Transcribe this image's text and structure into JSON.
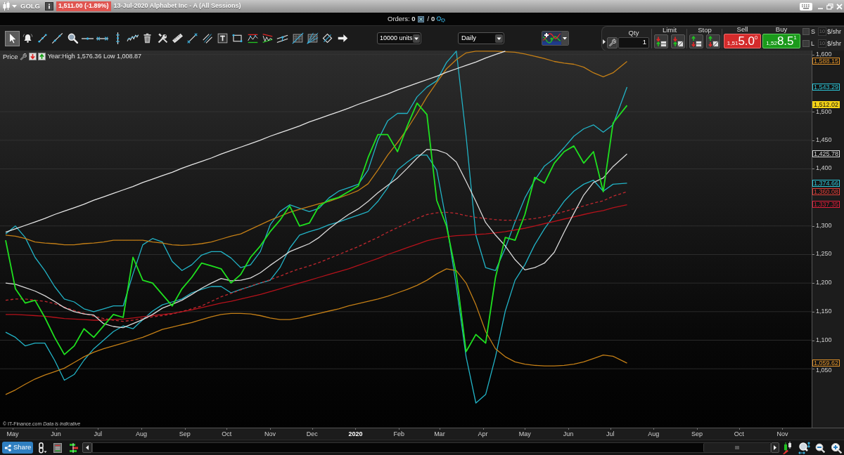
{
  "title_bar": {
    "symbol": "GOLG",
    "quote": {
      "text": "1,511.00 (-1.89%)",
      "down": true
    },
    "description": "13-Jul-2020 Alphabet Inc - A (All Sessions)"
  },
  "orders_bar": {
    "orders": "Orders: **0**",
    "filled": "/ **0**"
  },
  "toolbar": {
    "tools": [
      {
        "kind": "pointer",
        "selected": true
      },
      {
        "kind": "alert",
        "selected": false
      },
      {
        "kind": "segment",
        "selected": false
      },
      {
        "kind": "line",
        "selected": false
      },
      {
        "kind": "zoom",
        "selected": false
      },
      {
        "kind": "hline",
        "selected": false
      },
      {
        "kind": "hray",
        "selected": false
      },
      {
        "kind": "vline",
        "selected": false
      },
      {
        "kind": "wave",
        "selected": false
      },
      {
        "kind": "trash",
        "selected": false
      },
      {
        "kind": "tools",
        "selected": false
      },
      {
        "kind": "ruler",
        "selected": false
      },
      {
        "kind": "arrows",
        "selected": false
      },
      {
        "kind": "parallel",
        "selected": false
      },
      {
        "kind": "text",
        "selected": false
      },
      {
        "kind": "rect",
        "selected": false
      },
      {
        "kind": "channel",
        "selected": false
      },
      {
        "kind": "wedge",
        "selected": false
      },
      {
        "kind": "trend-channel",
        "selected": false
      },
      {
        "kind": "grid",
        "selected": false
      },
      {
        "kind": "grid-fan",
        "selected": false
      },
      {
        "kind": "diamond",
        "selected": false
      },
      {
        "kind": "arrow",
        "selected": false
      }
    ],
    "units": "10000 units",
    "interval": "Daily"
  },
  "trade_ticket": {
    "qty": {
      "label": "Qty",
      "value": "1"
    },
    "limit_label": "Limit",
    "stop_label": "Stop",
    "quotes": [
      {
        "kind": "sell",
        "label": "Sell",
        "prefix": "1,51",
        "big": "5.0",
        "pip": "0"
      },
      {
        "kind": "buy",
        "label": "Buy",
        "prefix": "1,52",
        "big": "8.5",
        "pip": "1"
      }
    ],
    "protections": [
      {
        "letter": "S",
        "checked": false,
        "amount": "10",
        "disabled": true,
        "unit": "$/shr"
      },
      {
        "letter": "L",
        "checked": false,
        "amount": "10",
        "disabled": true,
        "unit": "$/shr"
      }
    ]
  },
  "chart": {
    "header": {
      "label": "Price",
      "stats": "Year:High 1,576.36 Low 1,008.87"
    },
    "credit": "© IT-Finance.com *Data is indicative*",
    "price_tags": [
      {
        "text": "1,588.15",
        "color": "#e0922a",
        "filled": false
      },
      {
        "text": "1,543.29",
        "color": "#2cc6d8",
        "filled": false
      },
      {
        "text": "1,512.02",
        "color": "#f5d316",
        "filled": true
      },
      {
        "text": "1,425.78",
        "color": "#d6d6d6",
        "filled": false
      },
      {
        "text": "1,374.66",
        "color": "#2cc6d8",
        "filled": false
      },
      {
        "text": "1,360.08",
        "color": "#e0403a",
        "filled": false
      },
      {
        "text": "1,337.35",
        "color": "#e0203c",
        "filled": false
      },
      {
        "text": "1,059.62",
        "color": "#e0922a",
        "filled": false
      }
    ],
    "chart_data": {
      "type": "line",
      "grid": true,
      "xlim": [
        "2019-04-22",
        "2020-12-15"
      ],
      "ylim": [
        947,
        1607
      ],
      "x": [
        "2019-04-26",
        "2019-05-03",
        "2019-05-10",
        "2019-05-17",
        "2019-05-24",
        "2019-05-31",
        "2019-06-07",
        "2019-06-14",
        "2019-06-21",
        "2019-06-28",
        "2019-07-05",
        "2019-07-12",
        "2019-07-19",
        "2019-07-26",
        "2019-08-02",
        "2019-08-09",
        "2019-08-16",
        "2019-08-23",
        "2019-08-30",
        "2019-09-06",
        "2019-09-13",
        "2019-09-20",
        "2019-09-27",
        "2019-10-04",
        "2019-10-11",
        "2019-10-18",
        "2019-10-25",
        "2019-11-01",
        "2019-11-08",
        "2019-11-15",
        "2019-11-22",
        "2019-11-29",
        "2019-12-06",
        "2019-12-13",
        "2019-12-20",
        "2019-12-27",
        "2020-01-03",
        "2020-01-10",
        "2020-01-17",
        "2020-01-24",
        "2020-01-31",
        "2020-02-07",
        "2020-02-14",
        "2020-02-21",
        "2020-02-28",
        "2020-03-06",
        "2020-03-13",
        "2020-03-20",
        "2020-03-27",
        "2020-04-03",
        "2020-04-10",
        "2020-04-17",
        "2020-04-24",
        "2020-05-01",
        "2020-05-08",
        "2020-05-15",
        "2020-05-22",
        "2020-05-29",
        "2020-06-05",
        "2020-06-12",
        "2020-06-19",
        "2020-06-26",
        "2020-07-03",
        "2020-07-13"
      ],
      "xticks": [
        {
          "value": "2019-05-01",
          "label": "May"
        },
        {
          "value": "2019-06-01",
          "label": "Jun"
        },
        {
          "value": "2019-07-01",
          "label": "Jul"
        },
        {
          "value": "2019-08-01",
          "label": "Aug"
        },
        {
          "value": "2019-09-01",
          "label": "Sep"
        },
        {
          "value": "2019-10-01",
          "label": "Oct"
        },
        {
          "value": "2019-11-01",
          "label": "Nov"
        },
        {
          "value": "2019-12-01",
          "label": "Dec"
        },
        {
          "value": "2020-01-01",
          "label": "2020"
        },
        {
          "value": "2020-02-01",
          "label": "Feb"
        },
        {
          "value": "2020-03-01",
          "label": "Mar"
        },
        {
          "value": "2020-04-01",
          "label": "Apr"
        },
        {
          "value": "2020-05-01",
          "label": "May"
        },
        {
          "value": "2020-06-01",
          "label": "Jun"
        },
        {
          "value": "2020-07-01",
          "label": "Jul"
        },
        {
          "value": "2020-08-01",
          "label": "Aug"
        },
        {
          "value": "2020-09-01",
          "label": "Sep"
        },
        {
          "value": "2020-10-01",
          "label": "Oct"
        },
        {
          "value": "2020-11-01",
          "label": "Nov"
        }
      ],
      "yticks": [
        {
          "value": 1050,
          "label": "1,050"
        },
        {
          "value": 1100,
          "label": "1,100"
        },
        {
          "value": 1150,
          "label": "1,150"
        },
        {
          "value": 1200,
          "label": "1,200"
        },
        {
          "value": 1250,
          "label": "1,250"
        },
        {
          "value": 1300,
          "label": "1,300"
        },
        {
          "value": 1400,
          "label": "1,400"
        },
        {
          "value": 1450,
          "label": "1,450"
        },
        {
          "value": 1500,
          "label": "1,500"
        },
        {
          "value": 1600,
          "label": "1,600"
        }
      ],
      "series": [
        {
          "color": "#1fe01f",
          "values": [
            1275,
            1190,
            1165,
            1170,
            1140,
            1105,
            1075,
            1090,
            1120,
            1105,
            1125,
            1145,
            1140,
            1245,
            1205,
            1200,
            1180,
            1160,
            1190,
            1210,
            1235,
            1230,
            1225,
            1200,
            1215,
            1245,
            1265,
            1290,
            1310,
            1335,
            1300,
            1305,
            1335,
            1345,
            1350,
            1360,
            1370,
            1420,
            1460,
            1460,
            1430,
            1475,
            1515,
            1495,
            1345,
            1300,
            1215,
            1080,
            1110,
            1095,
            1210,
            1280,
            1275,
            1320,
            1385,
            1375,
            1410,
            1430,
            1440,
            1410,
            1430,
            1360,
            1480,
            1511
          ]
        },
        {
          "color": "#22b3c6",
          "values": [
            1286,
            1300,
            1280,
            1245,
            1222,
            1194,
            1172,
            1167,
            1155,
            1150,
            1155,
            1160,
            1160,
            1216,
            1267,
            1278,
            1272,
            1238,
            1222,
            1232,
            1249,
            1255,
            1255,
            1244,
            1227,
            1232,
            1255,
            1302,
            1325,
            1337,
            1331,
            1325,
            1331,
            1349,
            1361,
            1367,
            1373,
            1398,
            1450,
            1484,
            1497,
            1497,
            1526,
            1543,
            1554,
            1586,
            1606,
            1457,
            1284,
            1227,
            1222,
            1261,
            1307,
            1349,
            1380,
            1405,
            1418,
            1437,
            1457,
            1470,
            1477,
            1464,
            1477,
            1543
          ]
        },
        {
          "color": "#22b3c6",
          "values": [
            1114,
            1105,
            1090,
            1095,
            1095,
            1065,
            1030,
            1040,
            1065,
            1085,
            1100,
            1115,
            1125,
            1120,
            1136,
            1151,
            1162,
            1167,
            1172,
            1183,
            1189,
            1194,
            1194,
            1183,
            1189,
            1194,
            1200,
            1205,
            1227,
            1261,
            1284,
            1290,
            1295,
            1302,
            1307,
            1313,
            1319,
            1325,
            1343,
            1367,
            1398,
            1412,
            1424,
            1424,
            1398,
            1307,
            1194,
            1071,
            990,
            1005,
            1071,
            1151,
            1205,
            1232,
            1267,
            1295,
            1319,
            1343,
            1361,
            1373,
            1380,
            1361,
            1373,
            1375
          ]
        },
        {
          "color": "#c47f16",
          "values": [
            1284,
            1282,
            1278,
            1272,
            1270,
            1269,
            1267,
            1267,
            1269,
            1270,
            1272,
            1275,
            1275,
            1275,
            1275,
            1272,
            1270,
            1267,
            1266,
            1267,
            1269,
            1272,
            1277,
            1282,
            1286,
            1294,
            1302,
            1310,
            1317,
            1324,
            1329,
            1334,
            1339,
            1343,
            1349,
            1355,
            1362,
            1374,
            1398,
            1424,
            1446,
            1470,
            1497,
            1526,
            1551,
            1575,
            1591,
            1603,
            1606,
            1606,
            1606,
            1605,
            1604,
            1601,
            1597,
            1593,
            1588,
            1585,
            1583,
            1578,
            1568,
            1561,
            1568,
            1588
          ]
        },
        {
          "color": "#c47f16",
          "values": [
            1005,
            1013,
            1023,
            1032,
            1039,
            1045,
            1051,
            1061,
            1071,
            1079,
            1085,
            1090,
            1095,
            1100,
            1105,
            1112,
            1119,
            1123,
            1127,
            1131,
            1136,
            1141,
            1145,
            1147,
            1147,
            1146,
            1143,
            1139,
            1136,
            1136,
            1139,
            1143,
            1147,
            1151,
            1155,
            1160,
            1164,
            1168,
            1172,
            1177,
            1183,
            1189,
            1196,
            1205,
            1216,
            1225,
            1222,
            1200,
            1162,
            1115,
            1085,
            1071,
            1062,
            1058,
            1056,
            1055,
            1055,
            1056,
            1058,
            1062,
            1068,
            1074,
            1072,
            1060
          ]
        },
        {
          "color": "#b5121b",
          "values": [
            1145,
            1145,
            1144,
            1143,
            1142,
            1140,
            1138,
            1137,
            1136,
            1135,
            1135,
            1136,
            1137,
            1139,
            1141,
            1143,
            1145,
            1147,
            1150,
            1153,
            1157,
            1161,
            1165,
            1168,
            1172,
            1176,
            1180,
            1185,
            1190,
            1195,
            1200,
            1205,
            1210,
            1215,
            1220,
            1225,
            1231,
            1237,
            1243,
            1250,
            1256,
            1262,
            1268,
            1274,
            1278,
            1281,
            1283,
            1284,
            1285,
            1286,
            1288,
            1290,
            1293,
            1296,
            1300,
            1304,
            1308,
            1312,
            1316,
            1320,
            1324,
            1327,
            1332,
            1337
          ]
        },
        {
          "color": "#c0282f",
          "line_style": "dashed",
          "values": [
            1170,
            1172,
            1172,
            1170,
            1168,
            1164,
            1158,
            1152,
            1147,
            1142,
            1138,
            1135,
            1133,
            1135,
            1138,
            1141,
            1143,
            1146,
            1150,
            1155,
            1160,
            1168,
            1176,
            1182,
            1188,
            1195,
            1200,
            1206,
            1212,
            1219,
            1225,
            1230,
            1236,
            1243,
            1250,
            1257,
            1264,
            1272,
            1280,
            1289,
            1297,
            1305,
            1313,
            1320,
            1323,
            1324,
            1322,
            1318,
            1315,
            1313,
            1311,
            1310,
            1310,
            1311,
            1313,
            1316,
            1320,
            1325,
            1330,
            1335,
            1340,
            1344,
            1352,
            1360
          ]
        },
        {
          "color": "#d9d9d9",
          "values": [
            1200,
            1198,
            1192,
            1186,
            1178,
            1168,
            1157,
            1150,
            1146,
            1144,
            1129,
            1124,
            1122,
            1129,
            1136,
            1145,
            1156,
            1163,
            1170,
            1180,
            1191,
            1200,
            1208,
            1204,
            1205,
            1209,
            1218,
            1231,
            1243,
            1255,
            1262,
            1269,
            1280,
            1295,
            1308,
            1320,
            1330,
            1343,
            1358,
            1371,
            1384,
            1401,
            1419,
            1434,
            1433,
            1427,
            1412,
            1378,
            1343,
            1306,
            1284,
            1265,
            1241,
            1223,
            1227,
            1235,
            1254,
            1289,
            1322,
            1354,
            1376,
            1384,
            1404,
            1426
          ]
        },
        {
          "color": "#e6e6e6",
          "values": [
            1289,
            1295,
            1301,
            1307,
            1313,
            1320,
            1326,
            1332,
            1338,
            1345,
            1351,
            1357,
            1363,
            1369,
            1376,
            1382,
            1388,
            1394,
            1401,
            1407,
            1413,
            1419,
            1426,
            1432,
            1438,
            1444,
            1450,
            1457,
            1463,
            1469,
            1475,
            1482,
            1488,
            1494,
            1500,
            1506,
            1513,
            1519,
            1525,
            1531,
            1538,
            1544,
            1550,
            1556,
            1562,
            1569,
            1575,
            1581,
            1587,
            1594,
            1600,
            1606,
            null,
            null,
            null,
            null,
            null,
            null,
            null,
            null,
            null,
            null,
            null,
            null
          ]
        }
      ]
    }
  },
  "bottom_bar": {
    "share": "Share"
  }
}
